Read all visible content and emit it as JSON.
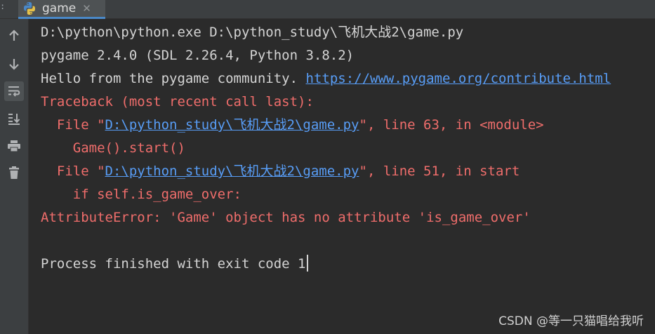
{
  "tab": {
    "edge_glyph": ":",
    "label": "game",
    "close": "✕",
    "icon": "python-file-icon"
  },
  "toolbar": {
    "items": [
      {
        "name": "scroll-up-icon"
      },
      {
        "name": "scroll-down-icon"
      },
      {
        "name": "soft-wrap-icon",
        "active": true
      },
      {
        "name": "scroll-to-end-icon"
      },
      {
        "name": "print-icon"
      },
      {
        "name": "clear-all-icon"
      }
    ]
  },
  "console": {
    "cmd": "D:\\python\\python.exe D:\\python_study\\飞机大战2\\game.py",
    "pygame_version": "pygame 2.4.0 (SDL 2.26.4, Python 3.8.2)",
    "hello_prefix": "Hello from the pygame community. ",
    "hello_link": "https://www.pygame.org/contribute.html",
    "traceback": "Traceback (most recent call last):",
    "frame1_prefix": "  File \"",
    "frame1_path": "D:\\python_study\\飞机大战2\\game.py",
    "frame1_suffix": "\", line 63, in <module>",
    "frame1_code": "    Game().start()",
    "frame2_prefix": "  File \"",
    "frame2_path": "D:\\python_study\\飞机大战2\\game.py",
    "frame2_suffix": "\", line 51, in start",
    "frame2_code": "    if self.is_game_over:",
    "error": "AttributeError: 'Game' object has no attribute 'is_game_over'",
    "finish": "Process finished with exit code 1"
  },
  "watermark": "CSDN @等一只猫唱给我听",
  "colors": {
    "background": "#2b2b2b",
    "text": "#d4d4d4",
    "error": "#ef6d6b",
    "link": "#589df6"
  }
}
